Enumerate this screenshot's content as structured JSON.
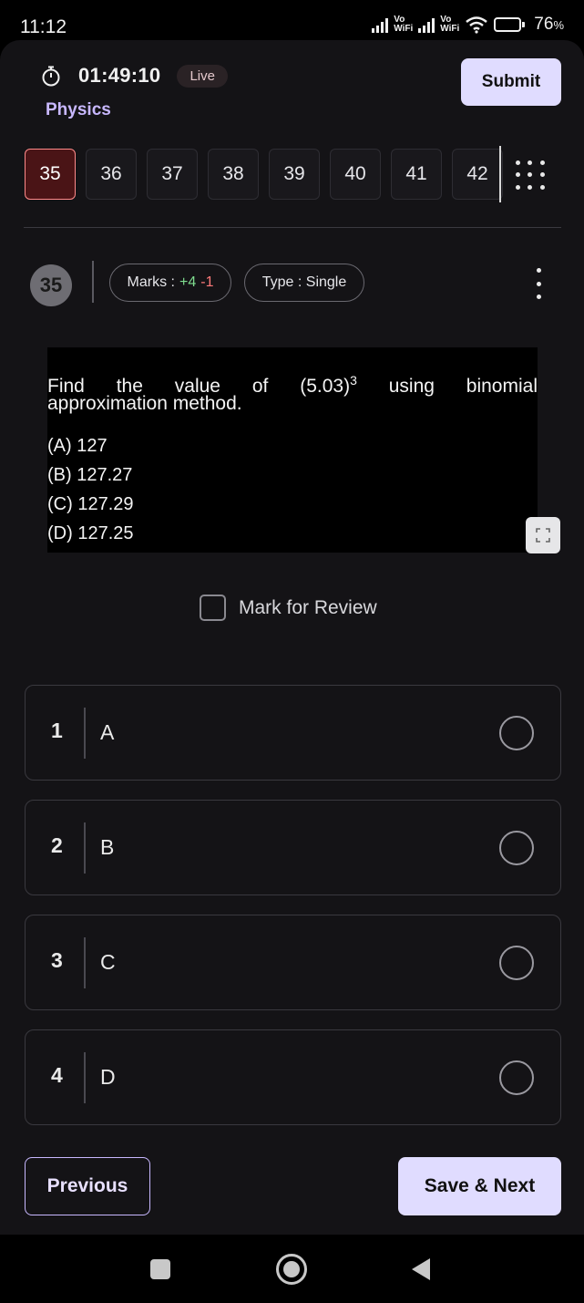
{
  "status_bar": {
    "time": "11:12",
    "sim1_label": [
      "Vo",
      "WiFi"
    ],
    "sim2_label": [
      "Vo",
      "WiFi"
    ],
    "battery_percent": 76,
    "battery_text": "76",
    "battery_unit": "%"
  },
  "header": {
    "timer": "01:49:10",
    "live_badge": "Live",
    "subject": "Physics",
    "submit_label": "Submit"
  },
  "question_nav": {
    "items": [
      "35",
      "36",
      "37",
      "38",
      "39",
      "40",
      "41",
      "42"
    ],
    "active_index": 0
  },
  "question": {
    "number": "35",
    "marks_label": "Marks :",
    "marks_positive": "+4",
    "marks_negative": "-1",
    "type_label": "Type :",
    "type_value": "Single",
    "text_line1_a": "Find the value of",
    "text_base": "(5.03)",
    "text_exp": "3",
    "text_line1_b": "using binomial",
    "text_line2": "approximation method.",
    "options": [
      "(A) 127",
      "(B) 127.27",
      "(C) 127.29",
      "(D) 127.25"
    ]
  },
  "review": {
    "label": "Mark for Review",
    "checked": false
  },
  "choices": [
    {
      "num": "1",
      "label": "A"
    },
    {
      "num": "2",
      "label": "B"
    },
    {
      "num": "3",
      "label": "C"
    },
    {
      "num": "4",
      "label": "D"
    }
  ],
  "footer": {
    "previous_label": "Previous",
    "next_label": "Save & Next"
  },
  "colors": {
    "accent": "#e0dcff",
    "active_question_bg": "#4a1416",
    "active_question_border": "#ff8a8a",
    "positive_mark": "#7fdc8f",
    "negative_mark": "#ff7a7a"
  },
  "icons": [
    "stopwatch-icon",
    "grid-menu-icon",
    "kebab-menu-icon",
    "expand-icon",
    "nav-recents-icon",
    "nav-home-icon",
    "nav-back-icon",
    "wifi-icon",
    "signal-icon",
    "battery-icon"
  ]
}
